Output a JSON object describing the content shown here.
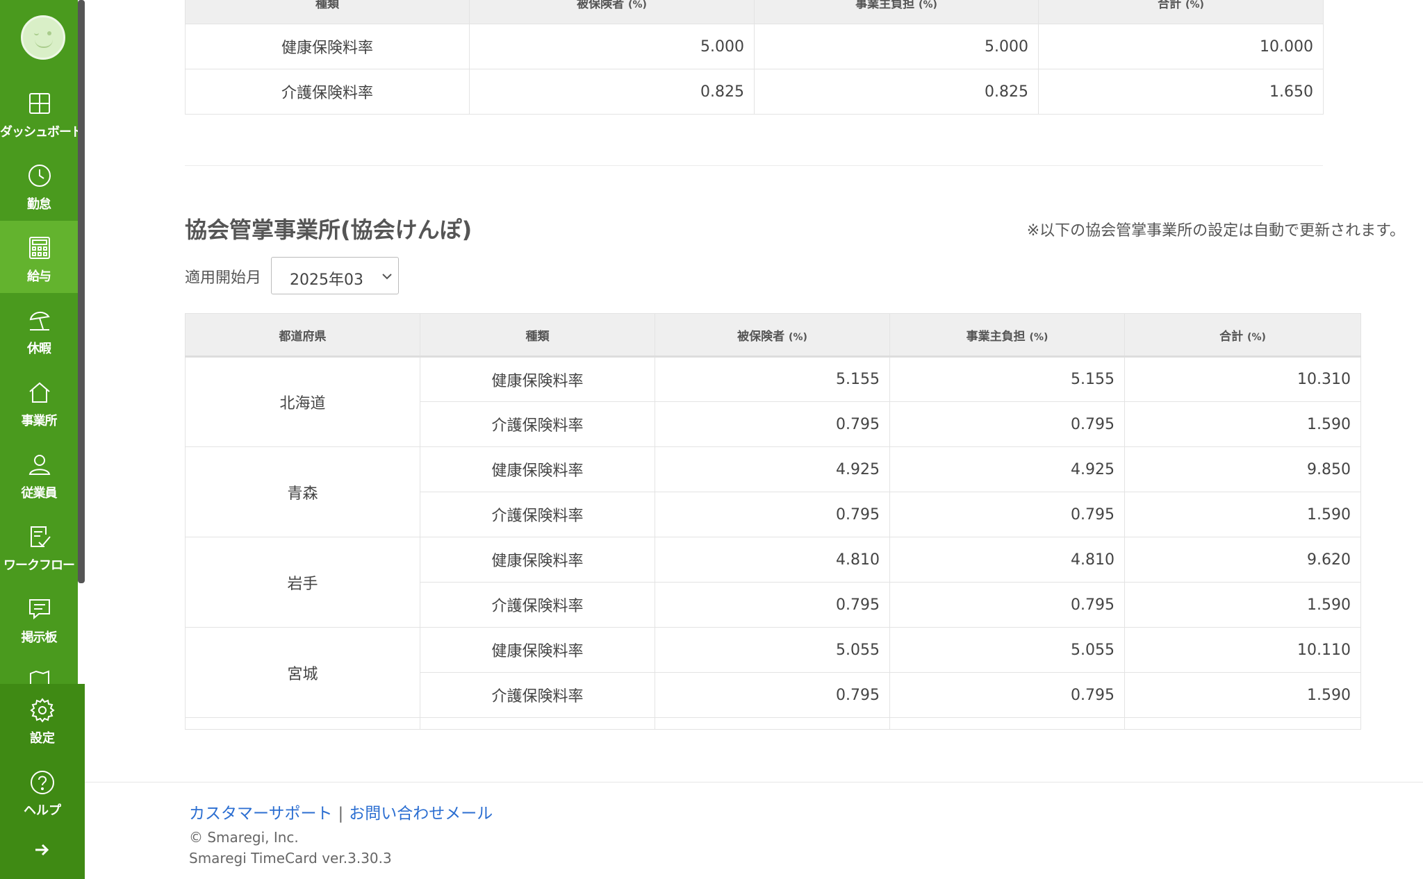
{
  "sidebar": {
    "items": [
      {
        "label": "ダッシュボード",
        "icon": "dashboard-icon"
      },
      {
        "label": "勤怠",
        "icon": "clock-icon"
      },
      {
        "label": "給与",
        "icon": "calculator-icon",
        "active": true
      },
      {
        "label": "休暇",
        "icon": "beach-umbrella-icon"
      },
      {
        "label": "事業所",
        "icon": "home-icon"
      },
      {
        "label": "従業員",
        "icon": "person-icon"
      },
      {
        "label": "ワークフロー",
        "icon": "checklist-icon"
      },
      {
        "label": "掲示板",
        "icon": "chat-icon"
      }
    ],
    "bottom": [
      {
        "label": "設定",
        "icon": "gear-icon"
      },
      {
        "label": "ヘルプ",
        "icon": "help-icon"
      }
    ]
  },
  "top_table": {
    "headers": [
      "種類",
      "被保険者",
      "事業主負担",
      "合計"
    ],
    "unit": "(%)",
    "rows": [
      {
        "type": "健康保険料率",
        "insured": "5.000",
        "employer": "5.000",
        "total": "10.000"
      },
      {
        "type": "介護保険料率",
        "insured": "0.825",
        "employer": "0.825",
        "total": "1.650"
      }
    ]
  },
  "section": {
    "title": "協会管掌事業所(協会けんぽ)",
    "note": "※以下の協会管掌事業所の設定は自動で更新されます。",
    "month_label": "適用開始月",
    "month_value": "2025年03"
  },
  "main_table": {
    "headers": [
      "都道府県",
      "種類",
      "被保険者",
      "事業主負担",
      "合計"
    ],
    "unit": "(%)",
    "prefectures": [
      {
        "name": "北海道",
        "rows": [
          {
            "type": "健康保険料率",
            "insured": "5.155",
            "employer": "5.155",
            "total": "10.310"
          },
          {
            "type": "介護保険料率",
            "insured": "0.795",
            "employer": "0.795",
            "total": "1.590"
          }
        ]
      },
      {
        "name": "青森",
        "rows": [
          {
            "type": "健康保険料率",
            "insured": "4.925",
            "employer": "4.925",
            "total": "9.850"
          },
          {
            "type": "介護保険料率",
            "insured": "0.795",
            "employer": "0.795",
            "total": "1.590"
          }
        ]
      },
      {
        "name": "岩手",
        "rows": [
          {
            "type": "健康保険料率",
            "insured": "4.810",
            "employer": "4.810",
            "total": "9.620"
          },
          {
            "type": "介護保険料率",
            "insured": "0.795",
            "employer": "0.795",
            "total": "1.590"
          }
        ]
      },
      {
        "name": "宮城",
        "rows": [
          {
            "type": "健康保険料率",
            "insured": "5.055",
            "employer": "5.055",
            "total": "10.110"
          },
          {
            "type": "介護保険料率",
            "insured": "0.795",
            "employer": "0.795",
            "total": "1.590"
          }
        ]
      }
    ]
  },
  "footer": {
    "support_link": "カスタマーサポート",
    "separator": "|",
    "contact_link": "お問い合わせメール",
    "copyright": "© Smaregi, Inc.",
    "version": "Smaregi TimeCard ver.3.30.3"
  }
}
